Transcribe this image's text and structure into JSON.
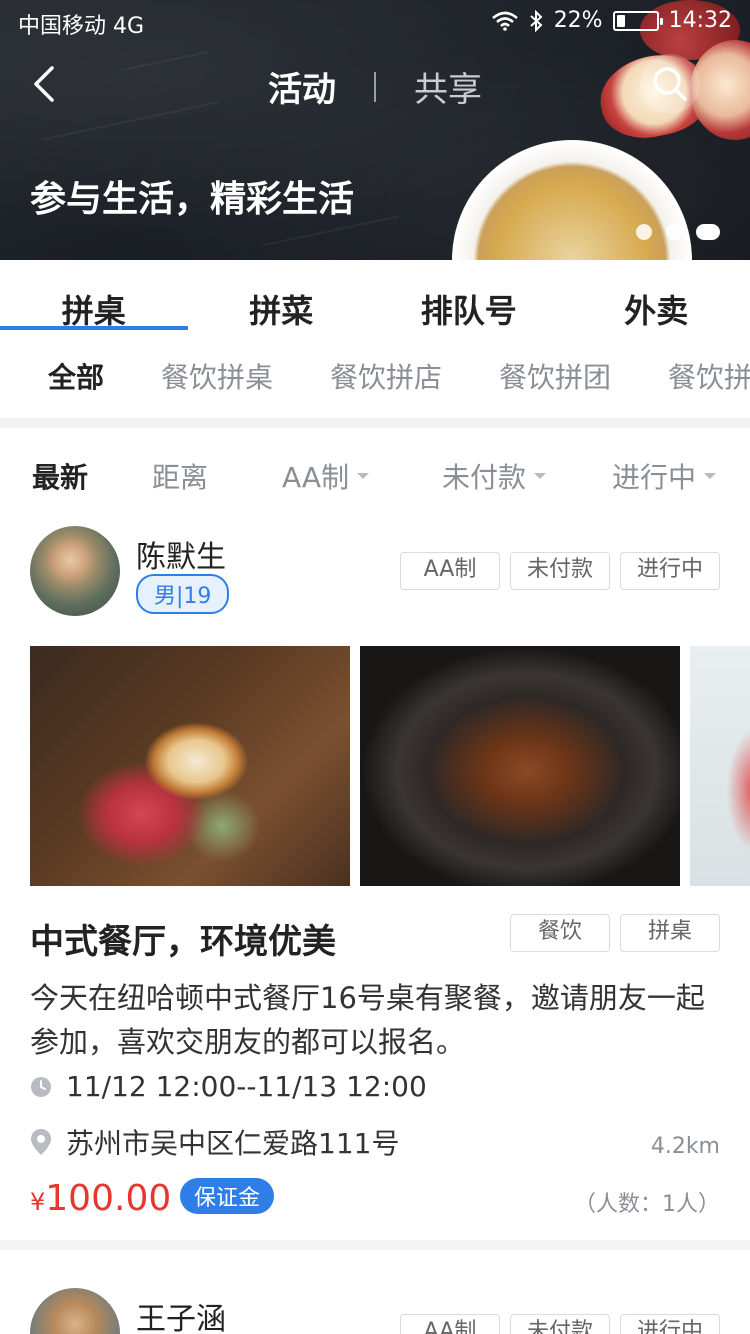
{
  "status_bar": {
    "carrier": "中国移动 4G",
    "battery_percent": "22%",
    "battery_level": 0.22,
    "time": "14:32"
  },
  "nav": {
    "tab_active": "活动",
    "tab_other": "共享",
    "slogan": "参与生活，精彩生活",
    "carousel_count": 3,
    "carousel_active_index": 2
  },
  "main_tabs": [
    "拼桌",
    "拼菜",
    "排队号",
    "外卖"
  ],
  "main_tab_active": 0,
  "sub_tabs": [
    "全部",
    "餐饮拼桌",
    "餐饮拼店",
    "餐饮拼团",
    "餐饮拼"
  ],
  "sub_tab_active": 0,
  "filters": {
    "latest": "最新",
    "distance": "距离",
    "pay_type": "AA制",
    "pay_status": "未付款",
    "progress": "进行中"
  },
  "posts": [
    {
      "user_name": "陈默生",
      "gender_age": "男|19",
      "tags": [
        "AA制",
        "未付款",
        "进行中"
      ],
      "title": "中式餐厅，环境优美",
      "category_tags": [
        "餐饮",
        "拼桌"
      ],
      "description": "今天在纽哈顿中式餐厅16号桌有聚餐，邀请朋友一起参加，喜欢交朋友的都可以报名。",
      "time_range": "11/12 12:00--11/13 12:00",
      "address": "苏州市吴中区仁爱路111号",
      "distance": "4.2km",
      "currency": "¥",
      "price": "100.00",
      "deposit_label": "保证金",
      "people": "（人数：1人）"
    },
    {
      "user_name": "王子涵",
      "tags": [
        "AA制",
        "未付款",
        "进行中"
      ]
    }
  ],
  "colors": {
    "accent": "#2f7ee8",
    "price": "#e8352f"
  }
}
